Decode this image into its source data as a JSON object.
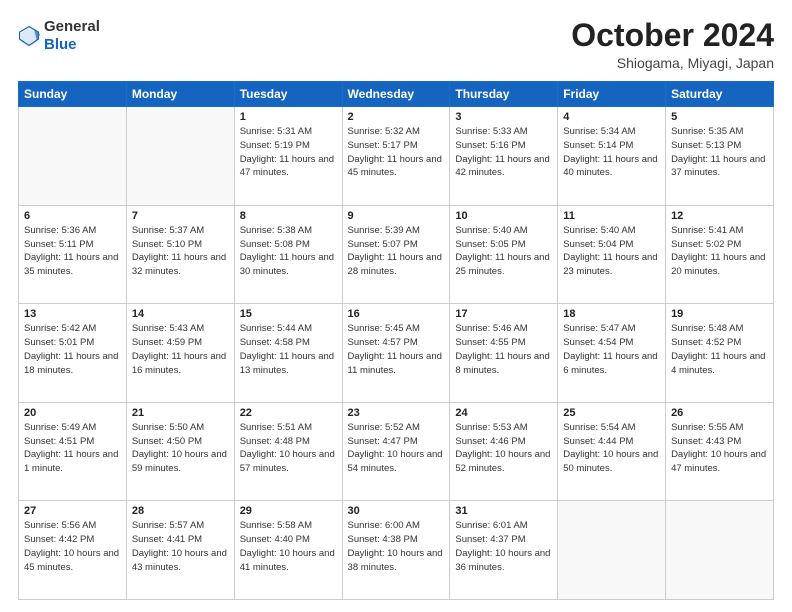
{
  "header": {
    "logo": {
      "general": "General",
      "blue": "Blue"
    },
    "title": "October 2024",
    "location": "Shiogama, Miyagi, Japan"
  },
  "days_of_week": [
    "Sunday",
    "Monday",
    "Tuesday",
    "Wednesday",
    "Thursday",
    "Friday",
    "Saturday"
  ],
  "weeks": [
    [
      {
        "day": "",
        "info": ""
      },
      {
        "day": "",
        "info": ""
      },
      {
        "day": "1",
        "info": "Sunrise: 5:31 AM\nSunset: 5:19 PM\nDaylight: 11 hours and 47 minutes."
      },
      {
        "day": "2",
        "info": "Sunrise: 5:32 AM\nSunset: 5:17 PM\nDaylight: 11 hours and 45 minutes."
      },
      {
        "day": "3",
        "info": "Sunrise: 5:33 AM\nSunset: 5:16 PM\nDaylight: 11 hours and 42 minutes."
      },
      {
        "day": "4",
        "info": "Sunrise: 5:34 AM\nSunset: 5:14 PM\nDaylight: 11 hours and 40 minutes."
      },
      {
        "day": "5",
        "info": "Sunrise: 5:35 AM\nSunset: 5:13 PM\nDaylight: 11 hours and 37 minutes."
      }
    ],
    [
      {
        "day": "6",
        "info": "Sunrise: 5:36 AM\nSunset: 5:11 PM\nDaylight: 11 hours and 35 minutes."
      },
      {
        "day": "7",
        "info": "Sunrise: 5:37 AM\nSunset: 5:10 PM\nDaylight: 11 hours and 32 minutes."
      },
      {
        "day": "8",
        "info": "Sunrise: 5:38 AM\nSunset: 5:08 PM\nDaylight: 11 hours and 30 minutes."
      },
      {
        "day": "9",
        "info": "Sunrise: 5:39 AM\nSunset: 5:07 PM\nDaylight: 11 hours and 28 minutes."
      },
      {
        "day": "10",
        "info": "Sunrise: 5:40 AM\nSunset: 5:05 PM\nDaylight: 11 hours and 25 minutes."
      },
      {
        "day": "11",
        "info": "Sunrise: 5:40 AM\nSunset: 5:04 PM\nDaylight: 11 hours and 23 minutes."
      },
      {
        "day": "12",
        "info": "Sunrise: 5:41 AM\nSunset: 5:02 PM\nDaylight: 11 hours and 20 minutes."
      }
    ],
    [
      {
        "day": "13",
        "info": "Sunrise: 5:42 AM\nSunset: 5:01 PM\nDaylight: 11 hours and 18 minutes."
      },
      {
        "day": "14",
        "info": "Sunrise: 5:43 AM\nSunset: 4:59 PM\nDaylight: 11 hours and 16 minutes."
      },
      {
        "day": "15",
        "info": "Sunrise: 5:44 AM\nSunset: 4:58 PM\nDaylight: 11 hours and 13 minutes."
      },
      {
        "day": "16",
        "info": "Sunrise: 5:45 AM\nSunset: 4:57 PM\nDaylight: 11 hours and 11 minutes."
      },
      {
        "day": "17",
        "info": "Sunrise: 5:46 AM\nSunset: 4:55 PM\nDaylight: 11 hours and 8 minutes."
      },
      {
        "day": "18",
        "info": "Sunrise: 5:47 AM\nSunset: 4:54 PM\nDaylight: 11 hours and 6 minutes."
      },
      {
        "day": "19",
        "info": "Sunrise: 5:48 AM\nSunset: 4:52 PM\nDaylight: 11 hours and 4 minutes."
      }
    ],
    [
      {
        "day": "20",
        "info": "Sunrise: 5:49 AM\nSunset: 4:51 PM\nDaylight: 11 hours and 1 minute."
      },
      {
        "day": "21",
        "info": "Sunrise: 5:50 AM\nSunset: 4:50 PM\nDaylight: 10 hours and 59 minutes."
      },
      {
        "day": "22",
        "info": "Sunrise: 5:51 AM\nSunset: 4:48 PM\nDaylight: 10 hours and 57 minutes."
      },
      {
        "day": "23",
        "info": "Sunrise: 5:52 AM\nSunset: 4:47 PM\nDaylight: 10 hours and 54 minutes."
      },
      {
        "day": "24",
        "info": "Sunrise: 5:53 AM\nSunset: 4:46 PM\nDaylight: 10 hours and 52 minutes."
      },
      {
        "day": "25",
        "info": "Sunrise: 5:54 AM\nSunset: 4:44 PM\nDaylight: 10 hours and 50 minutes."
      },
      {
        "day": "26",
        "info": "Sunrise: 5:55 AM\nSunset: 4:43 PM\nDaylight: 10 hours and 47 minutes."
      }
    ],
    [
      {
        "day": "27",
        "info": "Sunrise: 5:56 AM\nSunset: 4:42 PM\nDaylight: 10 hours and 45 minutes."
      },
      {
        "day": "28",
        "info": "Sunrise: 5:57 AM\nSunset: 4:41 PM\nDaylight: 10 hours and 43 minutes."
      },
      {
        "day": "29",
        "info": "Sunrise: 5:58 AM\nSunset: 4:40 PM\nDaylight: 10 hours and 41 minutes."
      },
      {
        "day": "30",
        "info": "Sunrise: 6:00 AM\nSunset: 4:38 PM\nDaylight: 10 hours and 38 minutes."
      },
      {
        "day": "31",
        "info": "Sunrise: 6:01 AM\nSunset: 4:37 PM\nDaylight: 10 hours and 36 minutes."
      },
      {
        "day": "",
        "info": ""
      },
      {
        "day": "",
        "info": ""
      }
    ]
  ]
}
